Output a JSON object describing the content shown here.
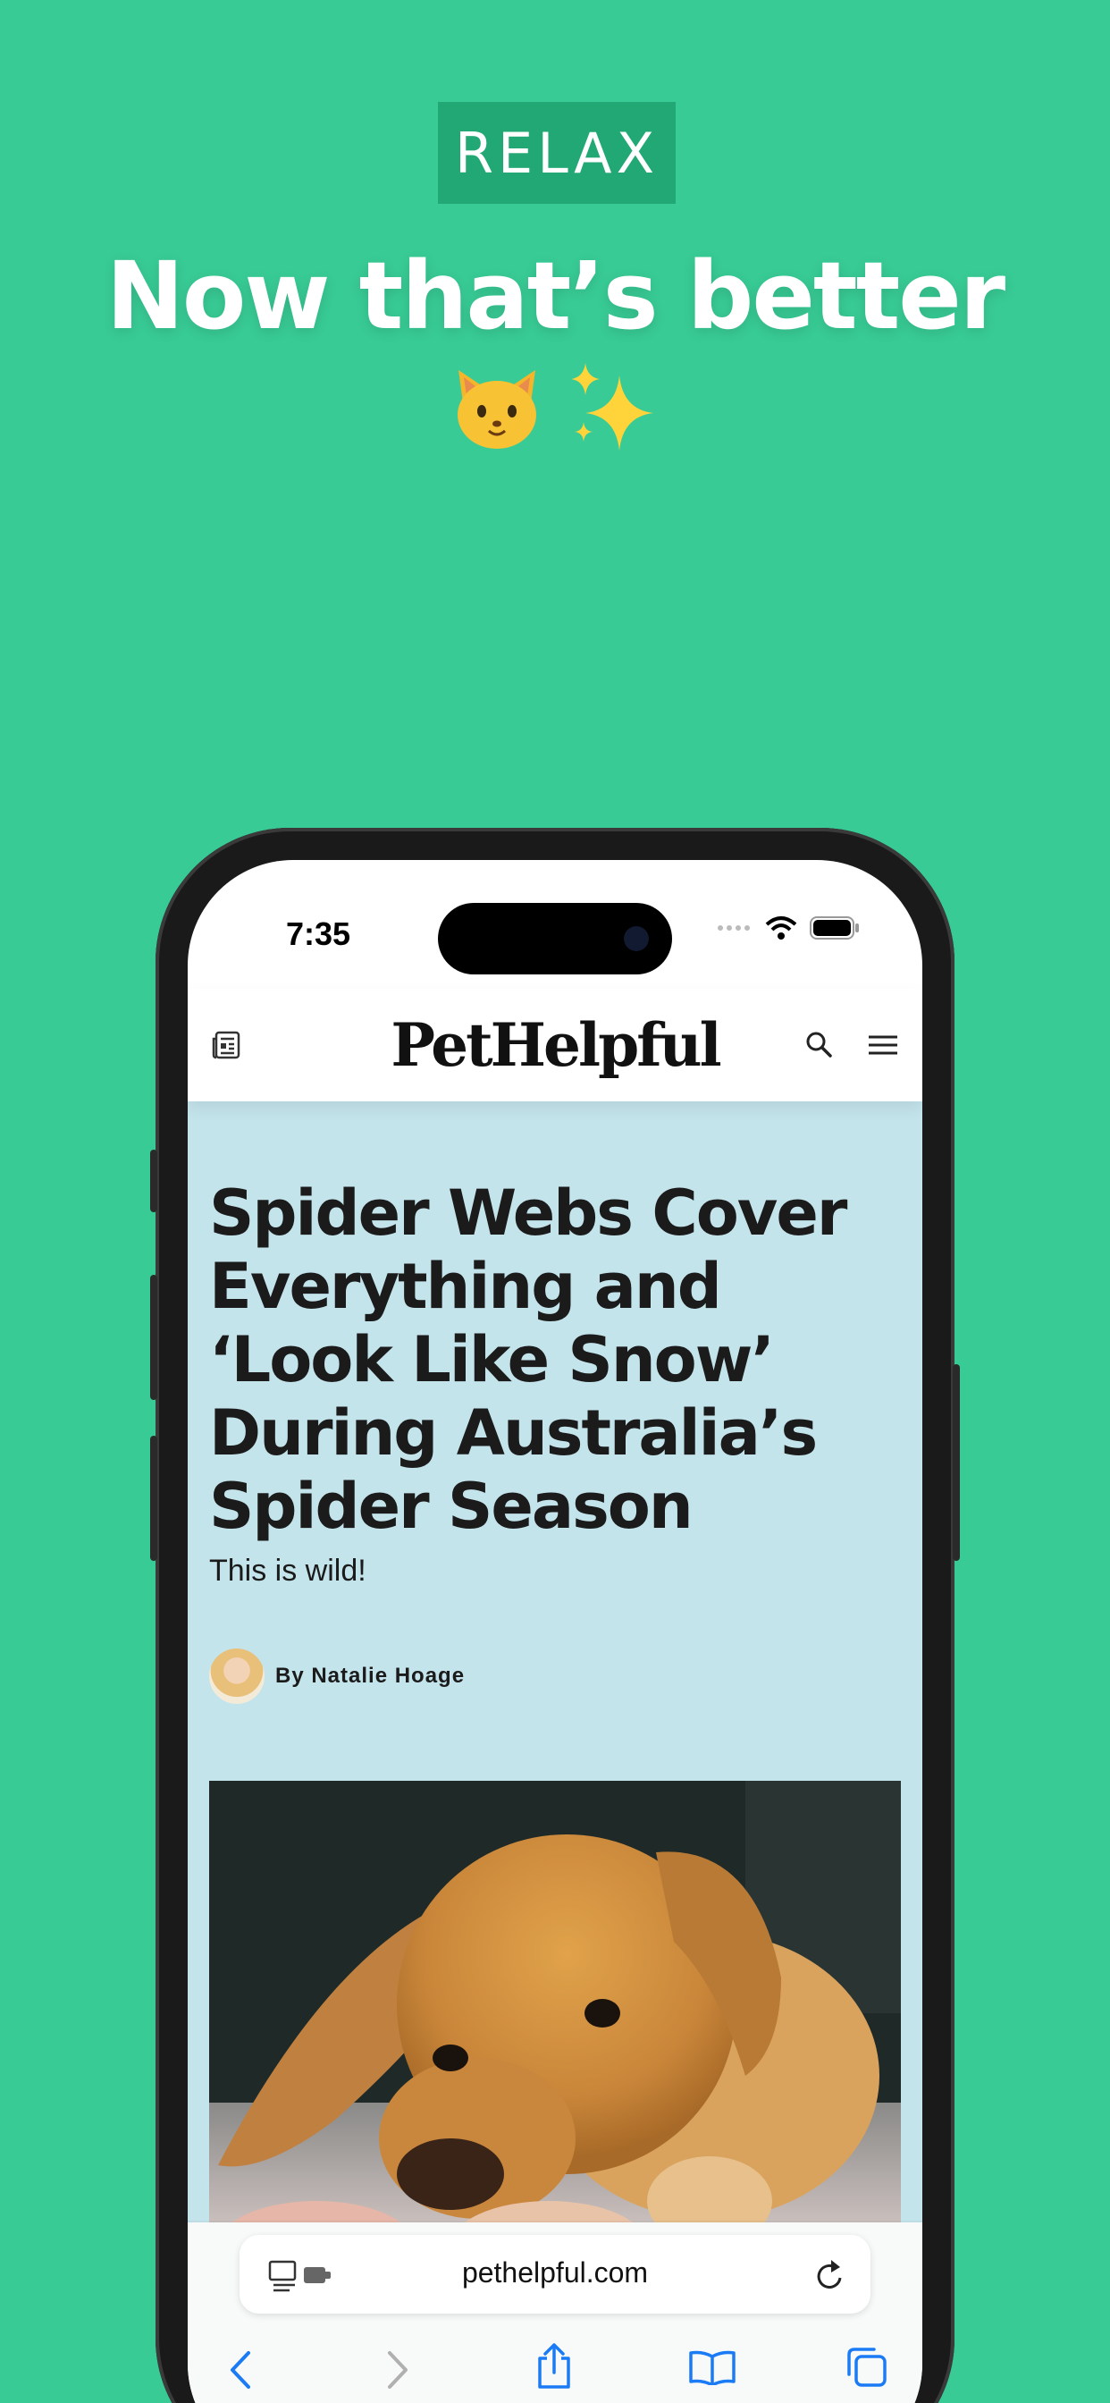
{
  "promo": {
    "badge": "RELAX",
    "headline": "Now that’s better"
  },
  "status_bar": {
    "time": "7:35"
  },
  "site": {
    "brand": "PetHelpful"
  },
  "article": {
    "title": "Spider Webs Cover Everything and ‘Look Like Snow’ During Australia’s Spider Season",
    "dek": "This is wild!",
    "byline": "By Natalie Hoage"
  },
  "browser": {
    "url": "pethelpful.com"
  },
  "colors": {
    "background": "#38CB95",
    "badge": "#22A875",
    "article_bg": "#C4E4EC",
    "accent_blue": "#1A7BF5"
  },
  "icons": [
    "news-icon",
    "search-icon",
    "menu-icon",
    "reader-icon",
    "reload-icon",
    "back-icon",
    "forward-icon",
    "share-icon",
    "bookmarks-icon",
    "tabs-icon",
    "wifi-icon",
    "battery-icon",
    "cat-emoji-icon",
    "sparkles-icon"
  ]
}
